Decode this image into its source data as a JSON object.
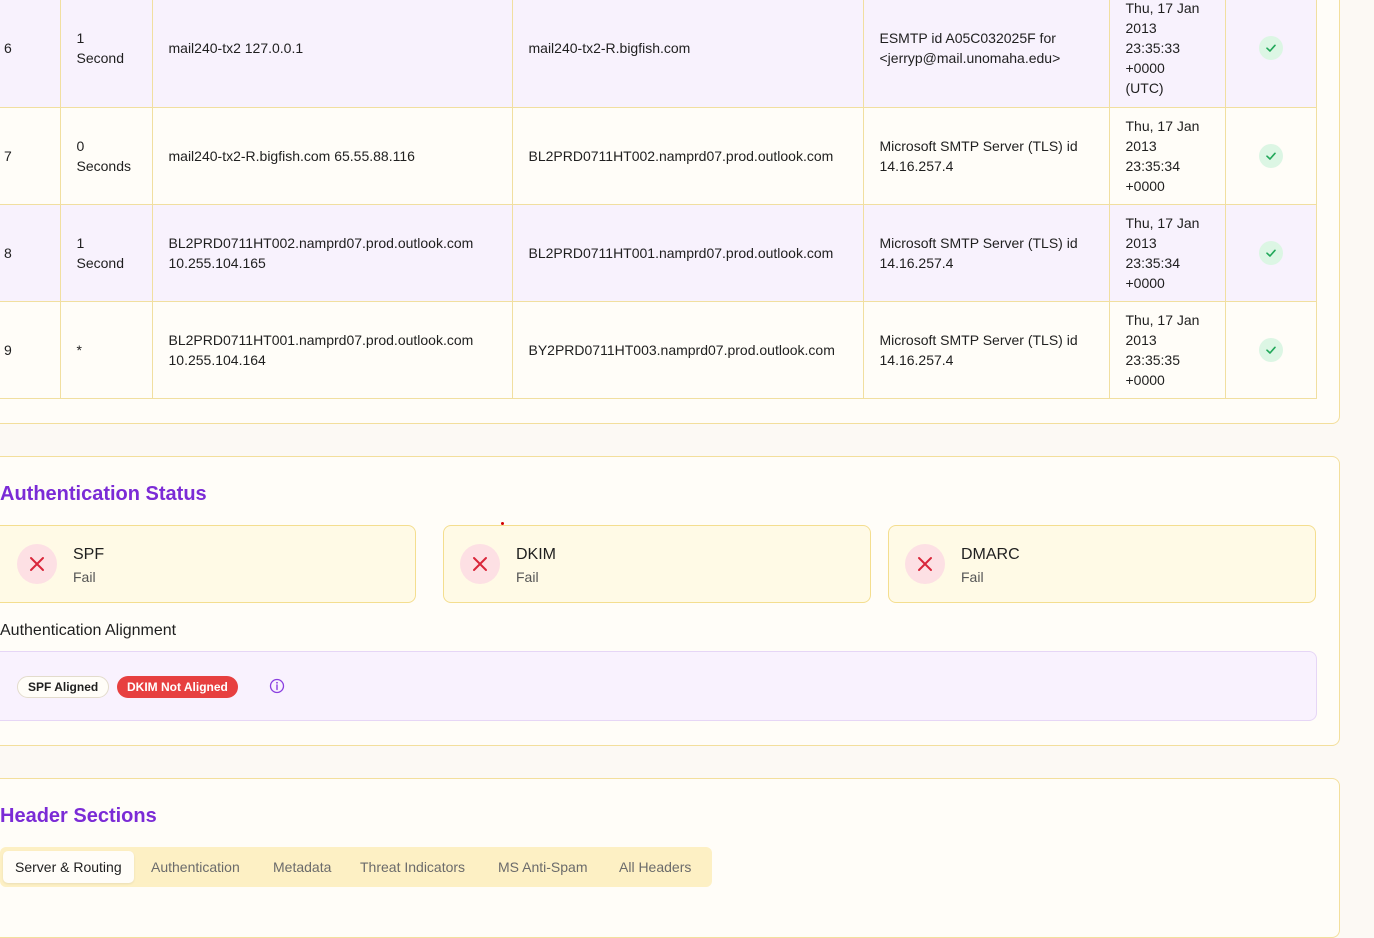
{
  "hops": [
    {
      "hop": "6",
      "delay": [
        "1",
        "Second"
      ],
      "from": [
        "mail240-tx2 127.0.0.1"
      ],
      "by": "mail240-tx2-R.bigfish.com",
      "with": [
        "ESMTP id A05C032025F for",
        "<jerryp@mail.unomaha.edu>"
      ],
      "time": [
        "Thu, 17 Jan",
        "2013",
        "23:35:33",
        "+0000",
        "(UTC)"
      ],
      "status": "check-icon"
    },
    {
      "hop": "7",
      "delay": [
        "0",
        "Seconds"
      ],
      "from": [
        "mail240-tx2-R.bigfish.com 65.55.88.116"
      ],
      "by": "BL2PRD0711HT002.namprd07.prod.outlook.com",
      "with": [
        "Microsoft SMTP Server (TLS) id",
        "14.16.257.4"
      ],
      "time": [
        "Thu, 17 Jan",
        "2013",
        "23:35:34",
        "+0000"
      ],
      "status": "check-icon"
    },
    {
      "hop": "8",
      "delay": [
        "1",
        "Second"
      ],
      "from": [
        "BL2PRD0711HT002.namprd07.prod.outlook.com",
        "10.255.104.165"
      ],
      "by": "BL2PRD0711HT001.namprd07.prod.outlook.com",
      "with": [
        "Microsoft SMTP Server (TLS) id",
        "14.16.257.4"
      ],
      "time": [
        "Thu, 17 Jan",
        "2013",
        "23:35:34",
        "+0000"
      ],
      "status": "check-icon"
    },
    {
      "hop": "9",
      "delay": [
        "*"
      ],
      "from": [
        "BL2PRD0711HT001.namprd07.prod.outlook.com",
        "10.255.104.164"
      ],
      "by": "BY2PRD0711HT003.namprd07.prod.outlook.com",
      "with": [
        "Microsoft SMTP Server (TLS) id",
        "14.16.257.4"
      ],
      "time": [
        "Thu, 17 Jan",
        "2013",
        "23:35:35",
        "+0000"
      ],
      "status": "check-icon"
    }
  ],
  "auth": {
    "title": "Authentication Status",
    "checks": [
      {
        "name": "SPF",
        "status": "Fail",
        "icon": "x-icon"
      },
      {
        "name": "DKIM",
        "status": "Fail",
        "icon": "x-icon"
      },
      {
        "name": "DMARC",
        "status": "Fail",
        "icon": "x-icon"
      }
    ],
    "alignment_title": "Authentication Alignment",
    "spf_aligned": "SPF Aligned",
    "dkim_not_aligned": "DKIM Not Aligned",
    "info_icon": "info-icon"
  },
  "headers": {
    "title": "Header Sections",
    "tabs": [
      "Server & Routing",
      "Authentication",
      "Metadata",
      "Threat Indicators",
      "MS Anti-Spam",
      "All Headers"
    ],
    "active_tab": "Server & Routing"
  },
  "colors": {
    "accent": "#7b2bd6",
    "fail": "#e74040",
    "success": "#22a85a",
    "row_tint": "#f8f2fd"
  }
}
